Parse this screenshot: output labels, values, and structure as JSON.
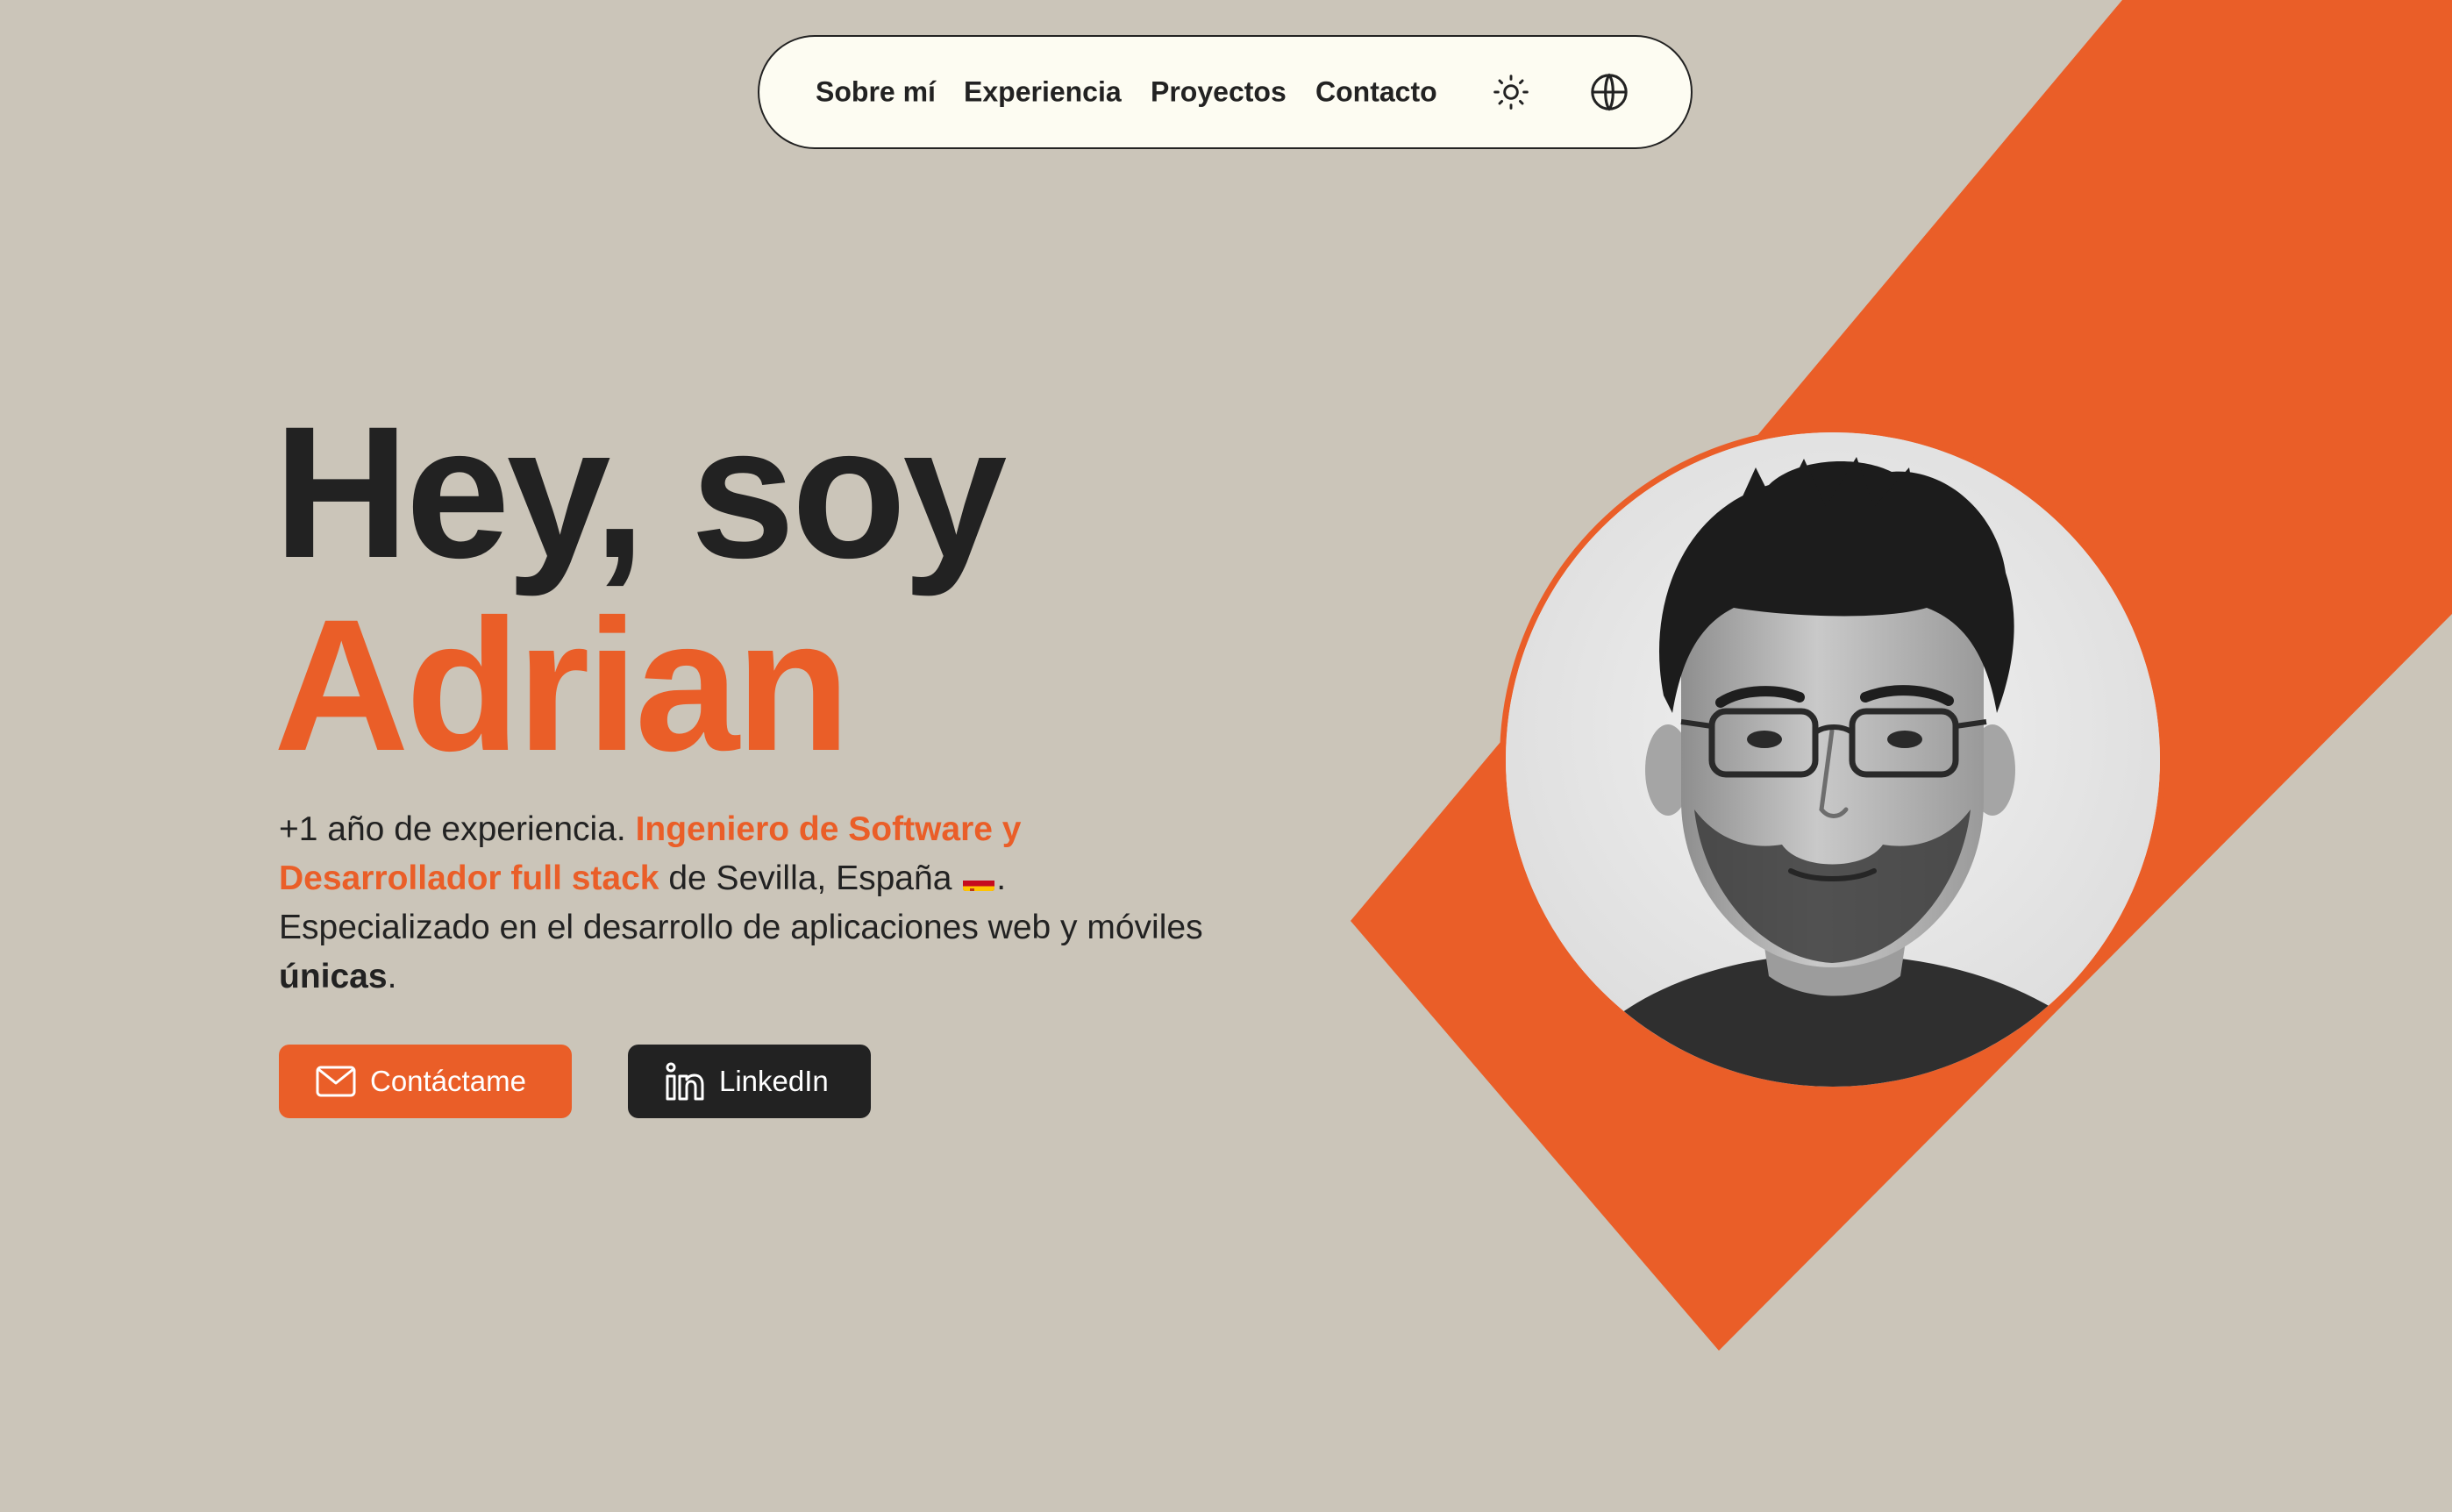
{
  "nav": {
    "links": [
      "Sobre mí",
      "Experiencia",
      "Proyectos",
      "Contacto"
    ],
    "theme_icon": "sun-icon",
    "language_icon": "globe-icon"
  },
  "hero": {
    "title_line1": "Hey, soy",
    "title_line2": "Adrian",
    "intro": {
      "part1": "+1 año de experiencia. ",
      "highlight": "Ingeniero de Software y Desarrollador full stack",
      "part2": " de Sevilla, España ",
      "part3": ". Especializado en el desarrollo de aplicaciones web y móviles ",
      "emphasis": "únicas",
      "part4": "."
    },
    "buttons": {
      "contact_label": "Contáctame",
      "contact_icon": "mail-icon",
      "linkedin_label": "LinkedIn",
      "linkedin_icon": "linkedin-icon"
    }
  },
  "colors": {
    "background": "#cbc5b9",
    "accent": "#ea5e28",
    "dark": "#222222",
    "nav_background": "#fdfcf2"
  }
}
